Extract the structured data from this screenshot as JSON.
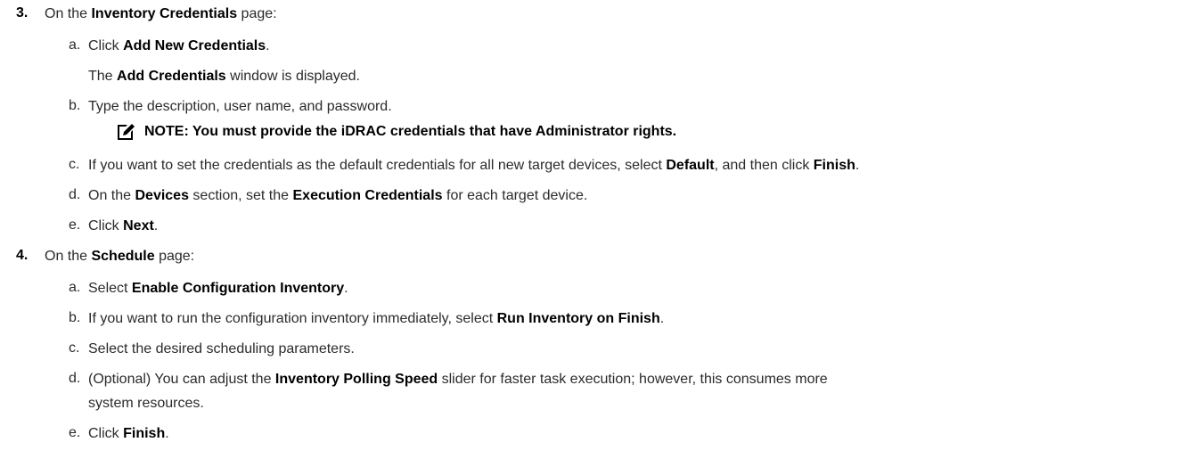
{
  "steps": [
    {
      "number": "3.",
      "intro": [
        "On the ",
        {
          "b": "Inventory Credentials"
        },
        " page:"
      ],
      "items": [
        {
          "letter": "a.",
          "segments": [
            "Click ",
            {
              "b": "Add New Credentials"
            },
            "."
          ]
        },
        {
          "letter": "",
          "segments": [
            "The ",
            {
              "b": "Add Credentials"
            },
            " window is displayed."
          ]
        },
        {
          "letter": "b.",
          "segments": [
            "Type the description, user name, and password."
          ]
        },
        {
          "letter": "c.",
          "segments": [
            "If you want to set the credentials as the default credentials for all new target devices, select ",
            {
              "b": "Default"
            },
            ", and then click ",
            {
              "b": "Finish"
            },
            "."
          ]
        },
        {
          "letter": "d.",
          "segments": [
            "On the ",
            {
              "b": "Devices"
            },
            " section, set the ",
            {
              "b": "Execution Credentials"
            },
            " for each target device."
          ]
        },
        {
          "letter": "e.",
          "segments": [
            "Click ",
            {
              "b": "Next"
            },
            "."
          ]
        }
      ]
    },
    {
      "number": "4.",
      "intro": [
        "On the ",
        {
          "b": "Schedule"
        },
        " page:"
      ],
      "items": [
        {
          "letter": "a.",
          "segments": [
            "Select ",
            {
              "b": "Enable Configuration Inventory"
            },
            "."
          ]
        },
        {
          "letter": "b.",
          "segments": [
            "If you want to run the configuration inventory immediately, select ",
            {
              "b": "Run Inventory on Finish"
            },
            "."
          ]
        },
        {
          "letter": "c.",
          "segments": [
            "Select the desired scheduling parameters."
          ]
        },
        {
          "letter": "d.",
          "segments": [
            "(Optional) You can adjust the ",
            {
              "b": "Inventory Polling Speed"
            },
            " slider for faster task execution; however, this consumes more"
          ]
        },
        {
          "letter": "",
          "segments": [
            "system resources."
          ]
        },
        {
          "letter": "e.",
          "segments": [
            "Click ",
            {
              "b": "Finish"
            },
            "."
          ]
        }
      ]
    }
  ],
  "note": {
    "icon": "pencil-note-icon",
    "text": "NOTE: You must provide the iDRAC credentials that have Administrator rights."
  }
}
